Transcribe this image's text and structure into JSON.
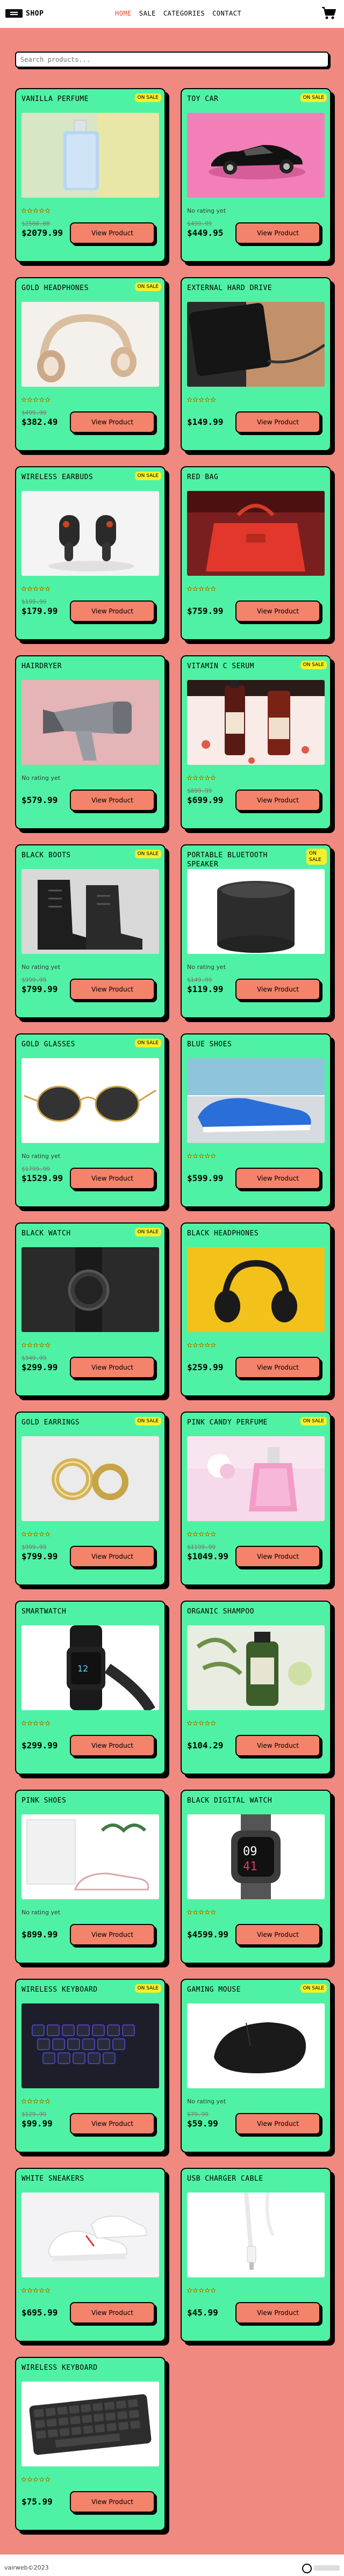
{
  "nav": {
    "brand": "SHOP",
    "links": [
      "HOME",
      "SALE",
      "CATEGORIES",
      "CONTACT"
    ]
  },
  "search": {
    "placeholder": "Search products..."
  },
  "product_button_label": "View Product",
  "no_rating_text": "No rating yet",
  "products": [
    {
      "name": "VANILLA PERFUME",
      "badge": "ON SALE",
      "rating": 5,
      "old_price": "$2500.00",
      "price": "$2079.99",
      "img": "perfume"
    },
    {
      "name": "TOY CAR",
      "badge": "ON SALE",
      "rating": 0,
      "old_price": "$499.99",
      "price": "$449.95",
      "img": "toycar"
    },
    {
      "name": "GOLD HEADPHONES",
      "badge": "ON SALE",
      "rating": 5,
      "old_price": "$499.99",
      "price": "$382.49",
      "img": "goldheadphones"
    },
    {
      "name": "EXTERNAL HARD DRIVE",
      "badge": "",
      "rating": 5,
      "old_price": "",
      "price": "$149.99",
      "img": "harddrive"
    },
    {
      "name": "WIRELESS EARBUDS",
      "badge": "ON SALE",
      "rating": 5,
      "old_price": "$199.99",
      "price": "$179.99",
      "img": "earbuds"
    },
    {
      "name": "RED BAG",
      "badge": "",
      "rating": 5,
      "old_price": "",
      "price": "$759.99",
      "img": "redbag"
    },
    {
      "name": "HAIRDRYER",
      "badge": "",
      "rating": 0,
      "old_price": "",
      "price": "$579.99",
      "img": "hairdryer"
    },
    {
      "name": "VITAMIN C SERUM",
      "badge": "ON SALE",
      "rating": 5,
      "old_price": "$899.99",
      "price": "$699.99",
      "img": "serum"
    },
    {
      "name": "BLACK BOOTS",
      "badge": "ON SALE",
      "rating": 0,
      "old_price": "$999.99",
      "price": "$799.99",
      "img": "boots"
    },
    {
      "name": "PORTABLE BLUETOOTH SPEAKER",
      "badge": "ON SALE",
      "rating": 0,
      "old_price": "$149.99",
      "price": "$119.99",
      "img": "speaker"
    },
    {
      "name": "GOLD GLASSES",
      "badge": "ON SALE",
      "rating": 0,
      "old_price": "$1799.99",
      "price": "$1529.99",
      "img": "glasses"
    },
    {
      "name": "BLUE SHOES",
      "badge": "",
      "rating": 5,
      "old_price": "",
      "price": "$599.99",
      "img": "blueshoes"
    },
    {
      "name": "BLACK WATCH",
      "badge": "ON SALE",
      "rating": 5,
      "old_price": "$349.99",
      "price": "$299.99",
      "img": "blackwatch"
    },
    {
      "name": "BLACK HEADPHONES",
      "badge": "",
      "rating": 5,
      "old_price": "",
      "price": "$259.99",
      "img": "blackheadphones"
    },
    {
      "name": "GOLD EARRINGS",
      "badge": "ON SALE",
      "rating": 5,
      "old_price": "$999.99",
      "price": "$799.99",
      "img": "earrings"
    },
    {
      "name": "PINK CANDY PERFUME",
      "badge": "ON SALE",
      "rating": 5,
      "old_price": "$1199.99",
      "price": "$1049.99",
      "img": "pinkperfume"
    },
    {
      "name": "SMARTWATCH",
      "badge": "",
      "rating": 5,
      "old_price": "",
      "price": "$299.99",
      "img": "smartwatch"
    },
    {
      "name": "ORGANIC SHAMPOO",
      "badge": "",
      "rating": 5,
      "old_price": "",
      "price": "$104.29",
      "img": "shampoo"
    },
    {
      "name": "PINK SHOES",
      "badge": "",
      "rating": 0,
      "old_price": "",
      "price": "$899.99",
      "img": "pinkshoes"
    },
    {
      "name": "BLACK DIGITAL WATCH",
      "badge": "",
      "rating": 5,
      "old_price": "",
      "price": "$4599.99",
      "img": "digitalwatch"
    },
    {
      "name": "WIRELESS KEYBOARD",
      "badge": "ON SALE",
      "rating": 5,
      "old_price": "$129.99",
      "price": "$99.99",
      "img": "gamingkeyboard"
    },
    {
      "name": "GAMING MOUSE",
      "badge": "ON SALE",
      "rating": 0,
      "old_price": "$79.99",
      "price": "$59.99",
      "img": "mouse"
    },
    {
      "name": "WHITE SNEAKERS",
      "badge": "",
      "rating": 5,
      "old_price": "",
      "price": "$695.99",
      "img": "sneakers"
    },
    {
      "name": "USB CHARGER CABLE",
      "badge": "",
      "rating": 5,
      "old_price": "",
      "price": "$45.99",
      "img": "cable"
    },
    {
      "name": "WIRELESS KEYBOARD",
      "badge": "",
      "rating": 5,
      "old_price": "",
      "price": "$75.99",
      "img": "keyboard"
    }
  ],
  "footer": {
    "text": "vairweb©2023"
  }
}
